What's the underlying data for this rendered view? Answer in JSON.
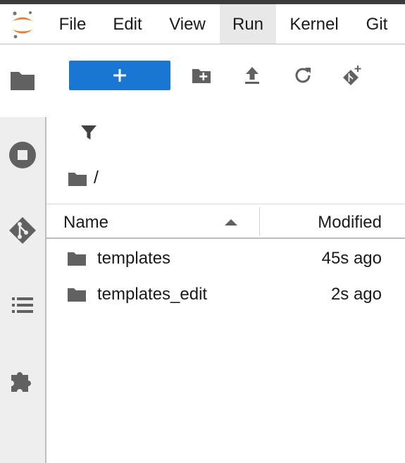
{
  "menubar": {
    "items": [
      {
        "label": "File"
      },
      {
        "label": "Edit"
      },
      {
        "label": "View"
      },
      {
        "label": "Run",
        "active": true
      },
      {
        "label": "Kernel"
      },
      {
        "label": "Git"
      }
    ]
  },
  "sidebar": {
    "tabs": [
      {
        "icon": "folder-icon",
        "active": true
      },
      {
        "icon": "stop-circle-icon"
      },
      {
        "icon": "git-icon"
      },
      {
        "icon": "list-icon"
      },
      {
        "icon": "extension-puzzle-icon"
      }
    ]
  },
  "toolbar": {
    "new_label": "+",
    "icons": [
      "new-folder-icon",
      "upload-icon",
      "refresh-icon",
      "git-clone-icon"
    ]
  },
  "filter": {
    "icon": "filter-icon"
  },
  "breadcrumb": {
    "path": "/"
  },
  "file_list": {
    "columns": {
      "name": "Name",
      "modified": "Modified"
    },
    "sort": {
      "column": "Name",
      "direction": "ascending"
    },
    "rows": [
      {
        "name": "templates",
        "modified": "45s ago",
        "type": "folder"
      },
      {
        "name": "templates_edit",
        "modified": "2s ago",
        "type": "folder"
      }
    ]
  },
  "colors": {
    "accent": "#1976d2",
    "icon": "#616161",
    "logo": "#f37726",
    "sidebar_bg": "#eeeeee"
  }
}
